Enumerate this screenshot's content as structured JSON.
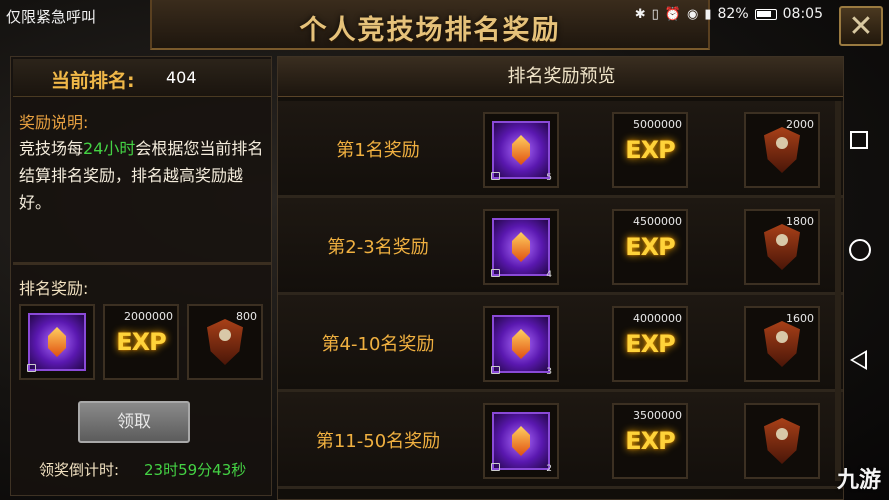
{
  "status_bar": {
    "left_text": "仅限紧急呼叫",
    "battery": "82%",
    "time": "08:05"
  },
  "title": "个人竞技场排名奖励",
  "current_rank": {
    "label": "当前排名:",
    "value": "404"
  },
  "description": {
    "title": "奖励说明:",
    "text_before": "竞技场每",
    "highlight": "24小时",
    "text_after": "会根据您当前排名结算排名奖励，排名越高奖励越好。"
  },
  "rank_rewards": {
    "title": "排名奖励:",
    "items": [
      {
        "icon": "purple-crystal-icon",
        "count": ""
      },
      {
        "icon": "exp-icon",
        "count": "2000000"
      },
      {
        "icon": "emblem-icon",
        "count": "800"
      }
    ]
  },
  "claim_button": "领取",
  "countdown": {
    "label": "领奖倒计时:",
    "value": "23时59分43秒"
  },
  "preview": {
    "header": "排名奖励预览",
    "rows": [
      {
        "label": "第1名奖励",
        "crystal_sub": "5",
        "exp": "5000000",
        "emblem": "2000"
      },
      {
        "label": "第2-3名奖励",
        "crystal_sub": "4",
        "exp": "4500000",
        "emblem": "1800"
      },
      {
        "label": "第4-10名奖励",
        "crystal_sub": "3",
        "exp": "4000000",
        "emblem": "1600"
      },
      {
        "label": "第11-50名奖励",
        "crystal_sub": "2",
        "exp": "3500000",
        "emblem": ""
      }
    ]
  },
  "exp_text": "EXP",
  "watermark": "九游",
  "colors": {
    "gold": "#f0b040",
    "green": "#44d244",
    "purple": "#8a4ad8"
  }
}
